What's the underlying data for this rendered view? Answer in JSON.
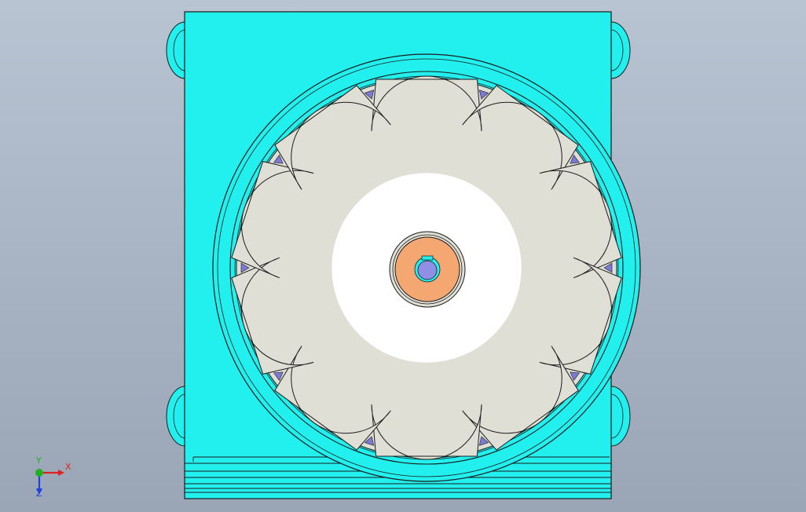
{
  "viewport": {
    "background_top": "#b8c4d2",
    "background_bottom": "#9aa6b6"
  },
  "model": {
    "colors": {
      "housing": "#22f0ee",
      "outline": "#1c1c1c",
      "lobe": "#e0dfd5",
      "hub": "#ffffff",
      "bushing": "#f5a772",
      "shaft": "#8f8fe6",
      "wedge": "#7b7bd6"
    },
    "lobe_count": 10
  },
  "triad": {
    "x_label": "X",
    "y_label": "Y",
    "z_label": "Z",
    "x_color": "#e02020",
    "y_color": "#20b020",
    "z_color": "#2040e0"
  }
}
